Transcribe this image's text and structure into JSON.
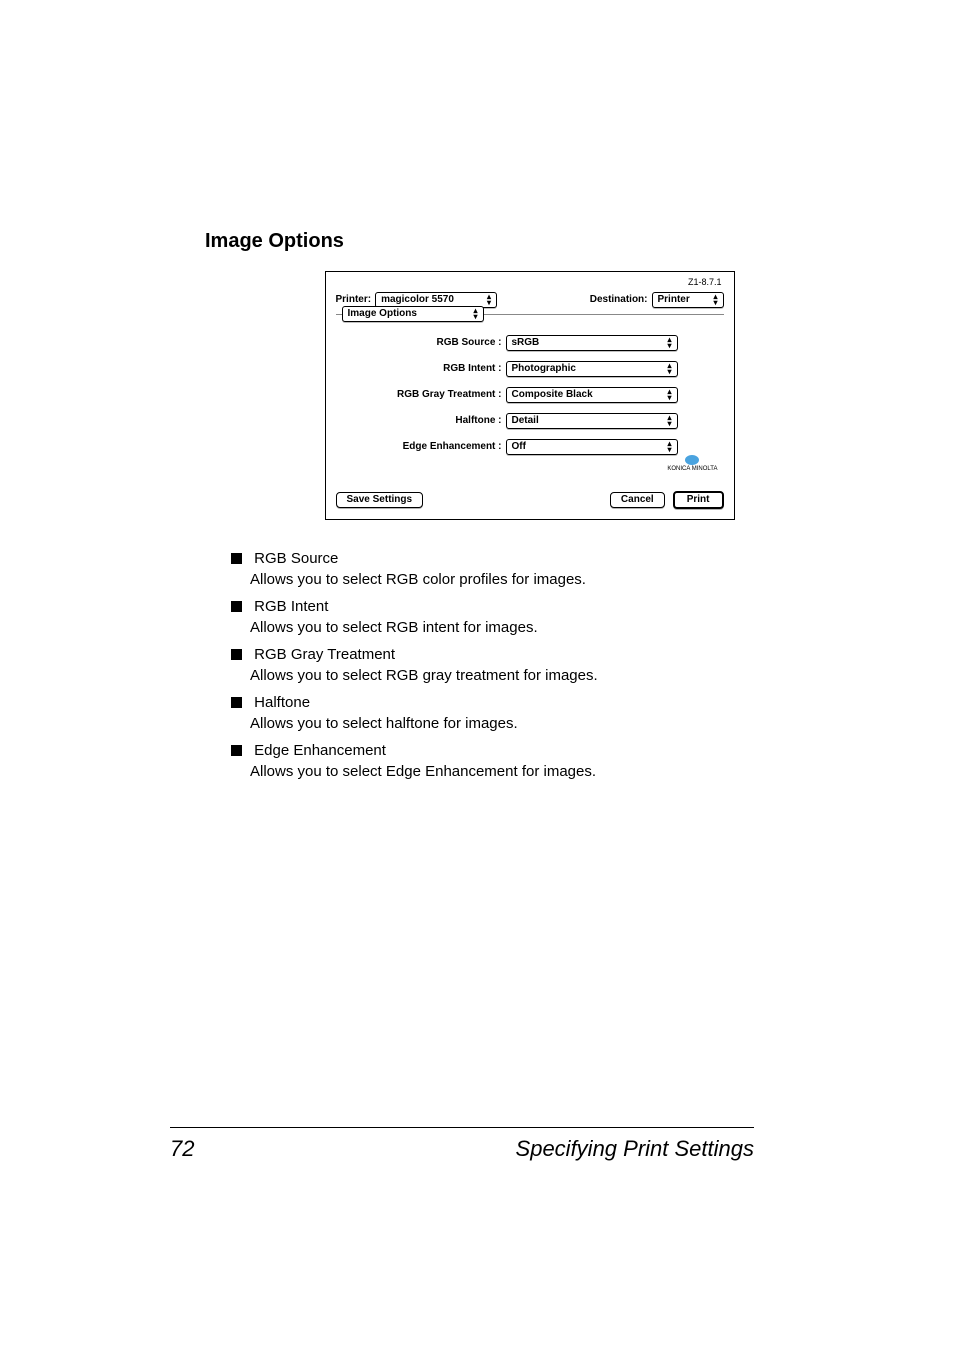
{
  "section_title": "Image Options",
  "dialog": {
    "version": "Z1-8.7.1",
    "printer_label": "Printer:",
    "printer_value": "magicolor 5570",
    "destination_label": "Destination:",
    "destination_value": "Printer",
    "pane": "Image Options",
    "fields": {
      "rgb_source": {
        "label": "RGB Source :",
        "value": "sRGB"
      },
      "rgb_intent": {
        "label": "RGB Intent :",
        "value": "Photographic"
      },
      "gray": {
        "label": "RGB Gray Treatment :",
        "value": "Composite Black"
      },
      "halftone": {
        "label": "Halftone :",
        "value": "Detail"
      },
      "edge": {
        "label": "Edge Enhancement :",
        "value": "Off"
      }
    },
    "logo_brand": "KONICA MINOLTA",
    "buttons": {
      "save": "Save Settings",
      "cancel": "Cancel",
      "print": "Print"
    }
  },
  "options": [
    {
      "title": "RGB Source",
      "desc": "Allows you to select RGB color profiles for images."
    },
    {
      "title": "RGB Intent",
      "desc": "Allows you to select RGB intent for images."
    },
    {
      "title": "RGB Gray Treatment",
      "desc": "Allows you to select RGB gray treatment for images."
    },
    {
      "title": "Halftone",
      "desc": "Allows you to select halftone for images."
    },
    {
      "title": "Edge Enhancement",
      "desc": "Allows you to select Edge Enhancement for images."
    }
  ],
  "footer": {
    "page_number": "72",
    "running_title": "Specifying Print Settings"
  }
}
